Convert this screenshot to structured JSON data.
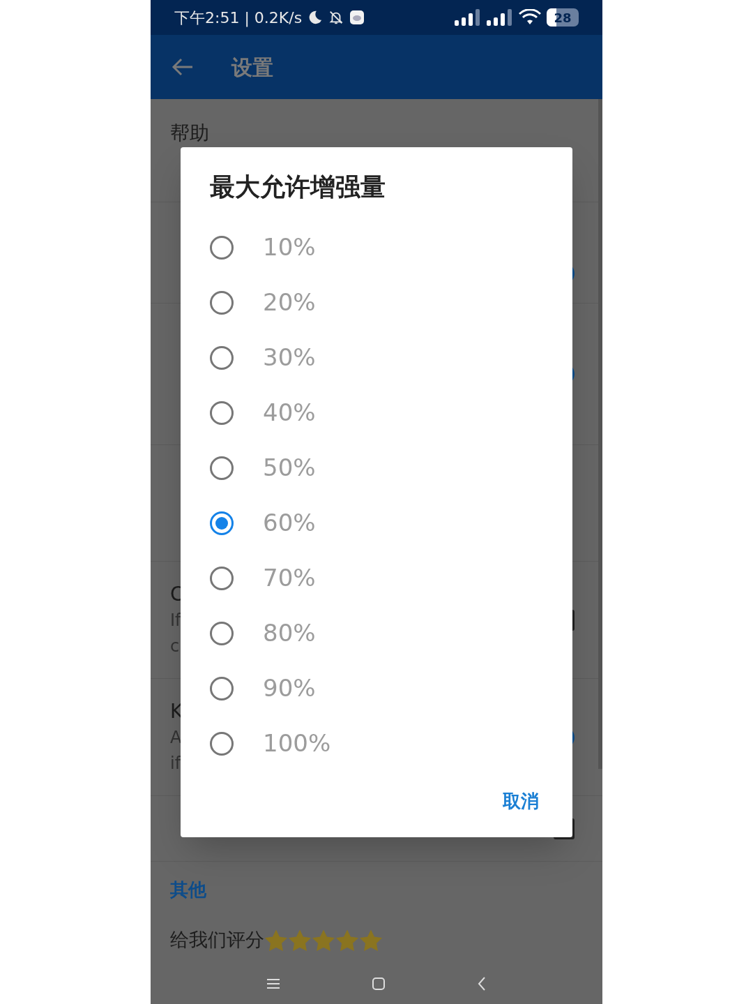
{
  "status_bar": {
    "time": "下午2:51 | 0.2K/s",
    "battery": "28"
  },
  "app_bar": {
    "title": "设置"
  },
  "settings": [
    {
      "kind": "item",
      "title": "帮助"
    },
    {
      "kind": "header"
    },
    {
      "kind": "item",
      "on": true
    },
    {
      "kind": "item",
      "on": true
    },
    {
      "kind": "item"
    },
    {
      "kind": "item",
      "title": "C",
      "summary": [
        "If",
        "c"
      ],
      "checked": false
    },
    {
      "kind": "item",
      "title": "K",
      "summary": [
        "A",
        "if"
      ],
      "on": true
    },
    {
      "kind": "item",
      "checked": false
    },
    {
      "kind": "header",
      "title": "其他"
    },
    {
      "kind": "rating",
      "title": "给我们评分",
      "stars": 5
    }
  ],
  "dialog": {
    "title": "最大允许增强量",
    "options": [
      {
        "label": "10%",
        "selected": false
      },
      {
        "label": "20%",
        "selected": false
      },
      {
        "label": "30%",
        "selected": false
      },
      {
        "label": "40%",
        "selected": false
      },
      {
        "label": "50%",
        "selected": false
      },
      {
        "label": "60%",
        "selected": true
      },
      {
        "label": "70%",
        "selected": false
      },
      {
        "label": "80%",
        "selected": false
      },
      {
        "label": "90%",
        "selected": false
      },
      {
        "label": "100%",
        "selected": false
      }
    ],
    "buttons": [
      "取消"
    ]
  }
}
